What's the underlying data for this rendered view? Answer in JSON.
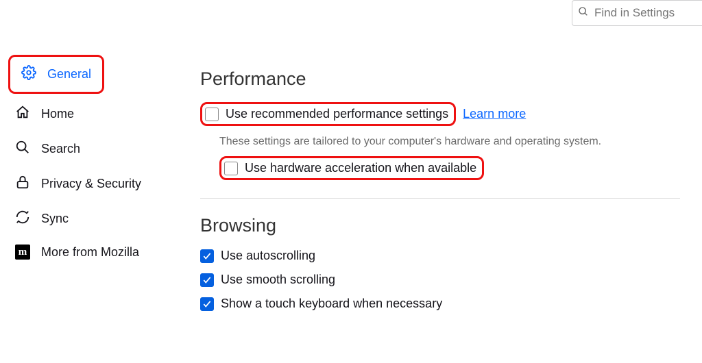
{
  "search": {
    "placeholder": "Find in Settings"
  },
  "sidebar": {
    "items": [
      {
        "label": "General"
      },
      {
        "label": "Home"
      },
      {
        "label": "Search"
      },
      {
        "label": "Privacy & Security"
      },
      {
        "label": "Sync"
      },
      {
        "label": "More from Mozilla"
      }
    ]
  },
  "performance": {
    "title": "Performance",
    "use_recommended": "Use recommended performance settings",
    "learn_more": "Learn more",
    "subtext": "These settings are tailored to your computer's hardware and operating system.",
    "hw_accel": "Use hardware acceleration when available"
  },
  "browsing": {
    "title": "Browsing",
    "autoscroll": "Use autoscrolling",
    "smooth": "Use smooth scrolling",
    "touchkb": "Show a touch keyboard when necessary"
  }
}
